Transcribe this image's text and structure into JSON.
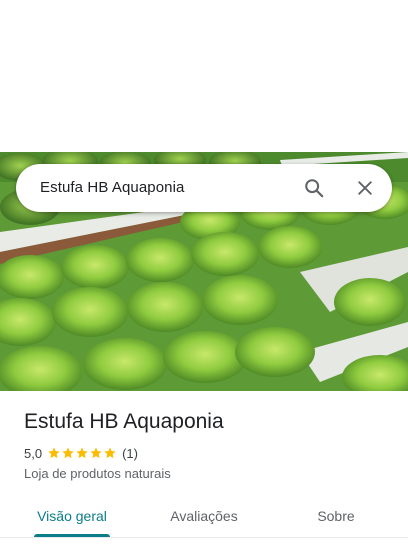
{
  "search": {
    "query": "Estufa HB Aquaponia",
    "search_icon": "search-icon",
    "close_icon": "close-icon"
  },
  "place": {
    "name": "Estufa HB Aquaponia",
    "rating": "5,0",
    "stars_filled": 5,
    "stars_total": 5,
    "review_count": "(1)",
    "category": "Loja de produtos naturais"
  },
  "tabs": [
    {
      "label": "Visão geral",
      "active": true
    },
    {
      "label": "Avaliações",
      "active": false
    },
    {
      "label": "Sobre",
      "active": false
    }
  ],
  "colors": {
    "accent": "#0b7c8a",
    "star": "#fbbc04",
    "text_primary": "#202124",
    "text_secondary": "#5f6368"
  }
}
